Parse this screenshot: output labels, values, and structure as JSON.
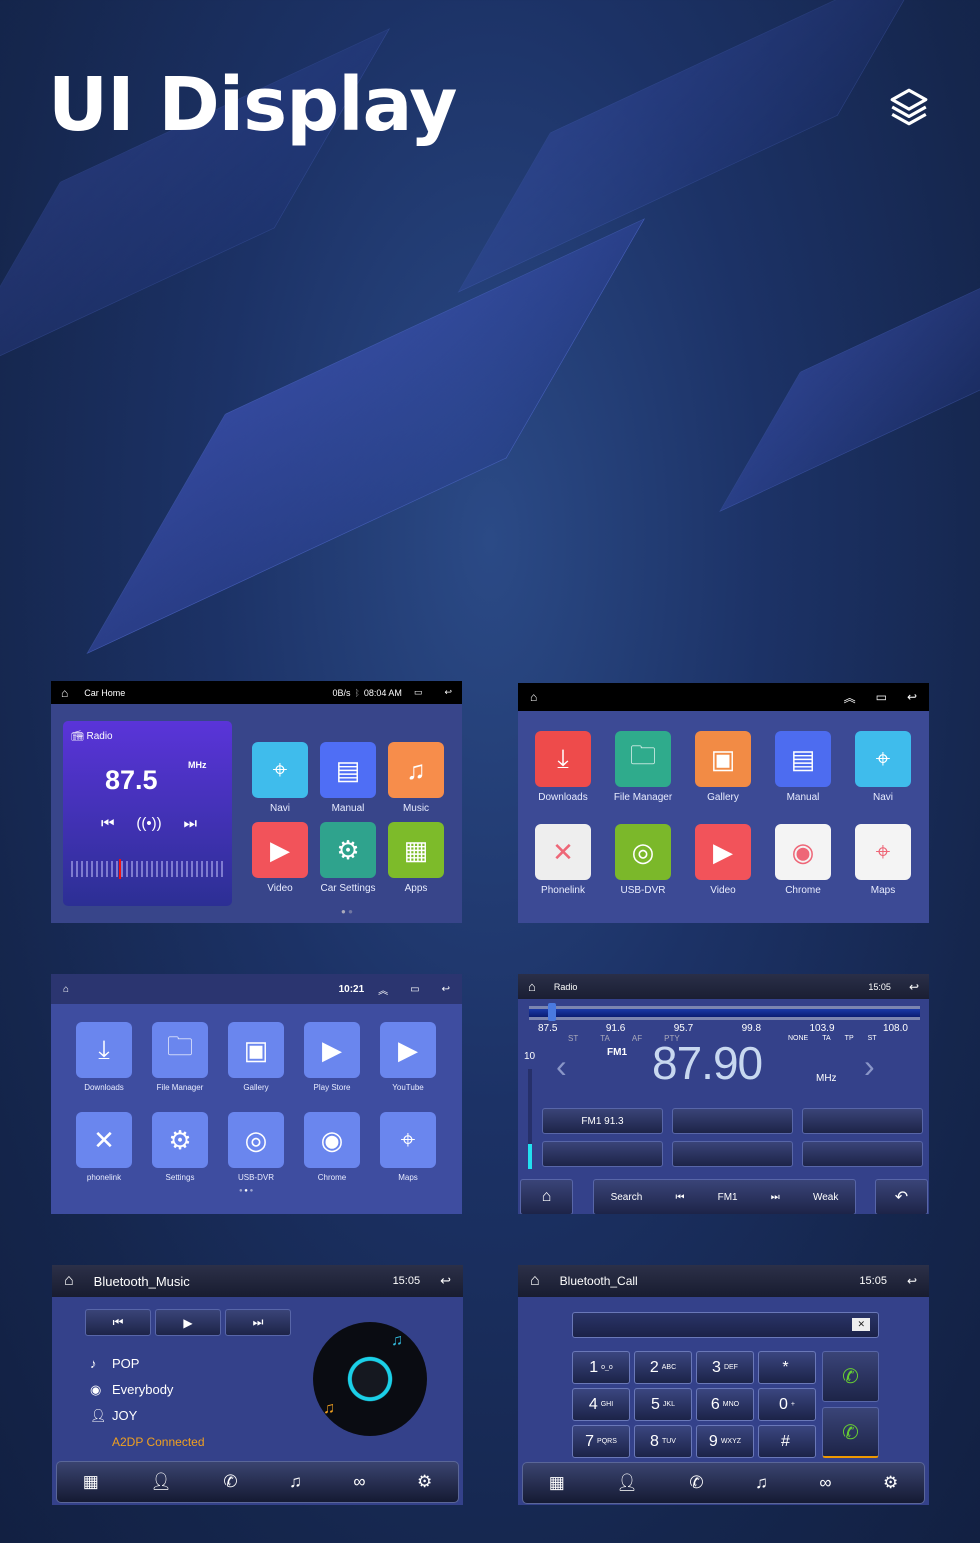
{
  "title": "UI Display",
  "icons": {
    "layers": "layers-icon"
  },
  "screen1": {
    "app_title": "Car Home",
    "net_speed": "0B/s",
    "time": "08:04 AM",
    "radio_label": "Radio",
    "frequency": "87.5",
    "unit": "MHz",
    "apps": [
      {
        "label": "Navi",
        "color": "#3fbcec",
        "glyph": "⌖"
      },
      {
        "label": "Manual",
        "color": "#4f6ef5",
        "glyph": "▤"
      },
      {
        "label": "Music",
        "color": "#f78d4b",
        "glyph": "♫"
      },
      {
        "label": "Video",
        "color": "#f2535a",
        "glyph": "▶"
      },
      {
        "label": "Car Settings",
        "color": "#2fa38d",
        "glyph": "⚙"
      },
      {
        "label": "Apps",
        "color": "#7dbb2a",
        "glyph": "▦"
      }
    ]
  },
  "screen2": {
    "apps": [
      {
        "label": "Downloads",
        "color": "#ee4b4b",
        "glyph": "⤓"
      },
      {
        "label": "File Manager",
        "color": "#2fab8c",
        "glyph": "🗀"
      },
      {
        "label": "Gallery",
        "color": "#f28b45",
        "glyph": "▣"
      },
      {
        "label": "Manual",
        "color": "#4d6cf0",
        "glyph": "▤"
      },
      {
        "label": "Navi",
        "color": "#3fbcec",
        "glyph": "⌖"
      },
      {
        "label": "Phonelink",
        "color": "#eeeeee",
        "glyph": "✕"
      },
      {
        "label": "USB-DVR",
        "color": "#7bb82a",
        "glyph": "◎"
      },
      {
        "label": "Video",
        "color": "#f2535a",
        "glyph": "▶"
      },
      {
        "label": "Chrome",
        "color": "#f4f4f4",
        "glyph": "◉"
      },
      {
        "label": "Maps",
        "color": "#f4f4f4",
        "glyph": "⌖"
      }
    ]
  },
  "screen3": {
    "time": "10:21",
    "apps": [
      {
        "label": "Downloads",
        "color": "#6a86ee",
        "glyph": "⤓"
      },
      {
        "label": "File Manager",
        "color": "#6a86ee",
        "glyph": "🗀"
      },
      {
        "label": "Gallery",
        "color": "#6a86ee",
        "glyph": "▣"
      },
      {
        "label": "Play Store",
        "color": "#6a86ee",
        "glyph": "▶"
      },
      {
        "label": "YouTube",
        "color": "#6a86ee",
        "glyph": "▶"
      },
      {
        "label": "phonelink",
        "color": "#6a86ee",
        "glyph": "✕"
      },
      {
        "label": "Settings",
        "color": "#6a86ee",
        "glyph": "⚙"
      },
      {
        "label": "USB-DVR",
        "color": "#6a86ee",
        "glyph": "◎"
      },
      {
        "label": "Chrome",
        "color": "#6a86ee",
        "glyph": "◉"
      },
      {
        "label": "Maps",
        "color": "#6a86ee",
        "glyph": "⌖"
      }
    ]
  },
  "screen4": {
    "title": "Radio",
    "time": "15:05",
    "scale": [
      "87.5",
      "91.6",
      "95.7",
      "99.8",
      "103.9",
      "108.0"
    ],
    "indicators": [
      "ST",
      "TA",
      "AF",
      "PTY"
    ],
    "flags": [
      "NONE",
      "TA",
      "TP",
      "ST"
    ],
    "volume": "10",
    "volume_level": 0.25,
    "band": "FM1",
    "frequency": "87.90",
    "unit": "MHz",
    "tuner_position": 0.05,
    "presets": [
      "FM1 91.3",
      "",
      "",
      "",
      "",
      ""
    ],
    "controls": {
      "search": "Search",
      "band": "FM1",
      "signal": "Weak"
    }
  },
  "screen5": {
    "title": "Bluetooth_Music",
    "time": "15:05",
    "genre": "POP",
    "album": "Everybody",
    "artist": "JOY",
    "status": "A2DP Connected",
    "status_color": "#f0a020"
  },
  "screen6": {
    "title": "Bluetooth_Call",
    "time": "15:05",
    "keys": [
      {
        "d": "1",
        "s": "ᴏ_ᴏ"
      },
      {
        "d": "2",
        "s": "ABC"
      },
      {
        "d": "3",
        "s": "DEF"
      },
      {
        "d": "*",
        "s": ""
      },
      {
        "d": "4",
        "s": "GHI"
      },
      {
        "d": "5",
        "s": "JKL"
      },
      {
        "d": "6",
        "s": "MNO"
      },
      {
        "d": "0",
        "s": "+"
      },
      {
        "d": "7",
        "s": "PQRS"
      },
      {
        "d": "8",
        "s": "TUV"
      },
      {
        "d": "9",
        "s": "WXYZ"
      },
      {
        "d": "#",
        "s": ""
      }
    ]
  },
  "dock": [
    "dialpad-icon",
    "contacts-icon",
    "call-log-icon",
    "music-icon",
    "link-icon",
    "settings-icon"
  ]
}
